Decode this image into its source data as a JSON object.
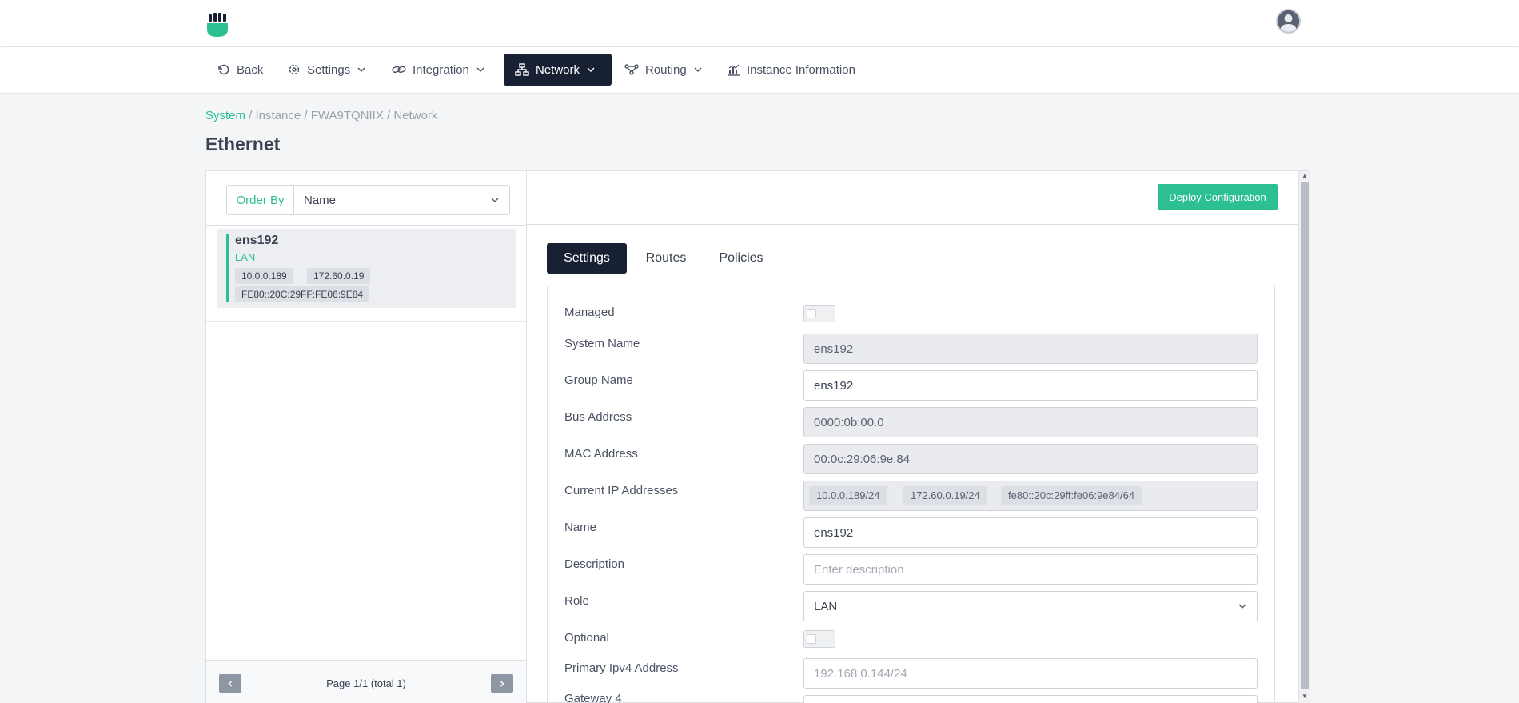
{
  "header": {
    "logo": "fist-logo",
    "avatar": "user-avatar-icon"
  },
  "nav": {
    "back": "Back",
    "settings": "Settings",
    "integration": "Integration",
    "network": "Network",
    "routing": "Routing",
    "instance_info": "Instance Information"
  },
  "breadcrumb": {
    "system": "System",
    "rest": " / Instance / FWA9TQNIIX / Network"
  },
  "page_title": "Ethernet",
  "list": {
    "order_by_label": "Order By",
    "order_by_value": "Name",
    "items": [
      {
        "name": "ens192",
        "role": "LAN",
        "ips": [
          "10.0.0.189",
          "172.60.0.19",
          "FE80::20C:29FF:FE06:9E84"
        ]
      }
    ],
    "pager_text": "Page 1/1 (total 1)"
  },
  "detail": {
    "deploy_button": "Deploy Configuration",
    "tabs": [
      "Settings",
      "Routes",
      "Policies"
    ],
    "fields": {
      "managed_label": "Managed",
      "system_name_label": "System Name",
      "system_name_value": "ens192",
      "group_name_label": "Group Name",
      "group_name_value": "ens192",
      "bus_address_label": "Bus Address",
      "bus_address_value": "0000:0b:00.0",
      "mac_label": "MAC Address",
      "mac_value": "00:0c:29:06:9e:84",
      "current_ips_label": "Current IP Addresses",
      "current_ips": [
        "10.0.0.189/24",
        "172.60.0.19/24",
        "fe80::20c:29ff:fe06:9e84/64"
      ],
      "name_label": "Name",
      "name_value": "ens192",
      "description_label": "Description",
      "description_placeholder": "Enter description",
      "role_label": "Role",
      "role_value": "LAN",
      "optional_label": "Optional",
      "primary_ipv4_label": "Primary Ipv4 Address",
      "primary_ipv4_placeholder": "192.168.0.144/24",
      "gateway_label": "Gateway 4"
    }
  },
  "colors": {
    "accent": "#2bbf92",
    "dark": "#182033"
  }
}
